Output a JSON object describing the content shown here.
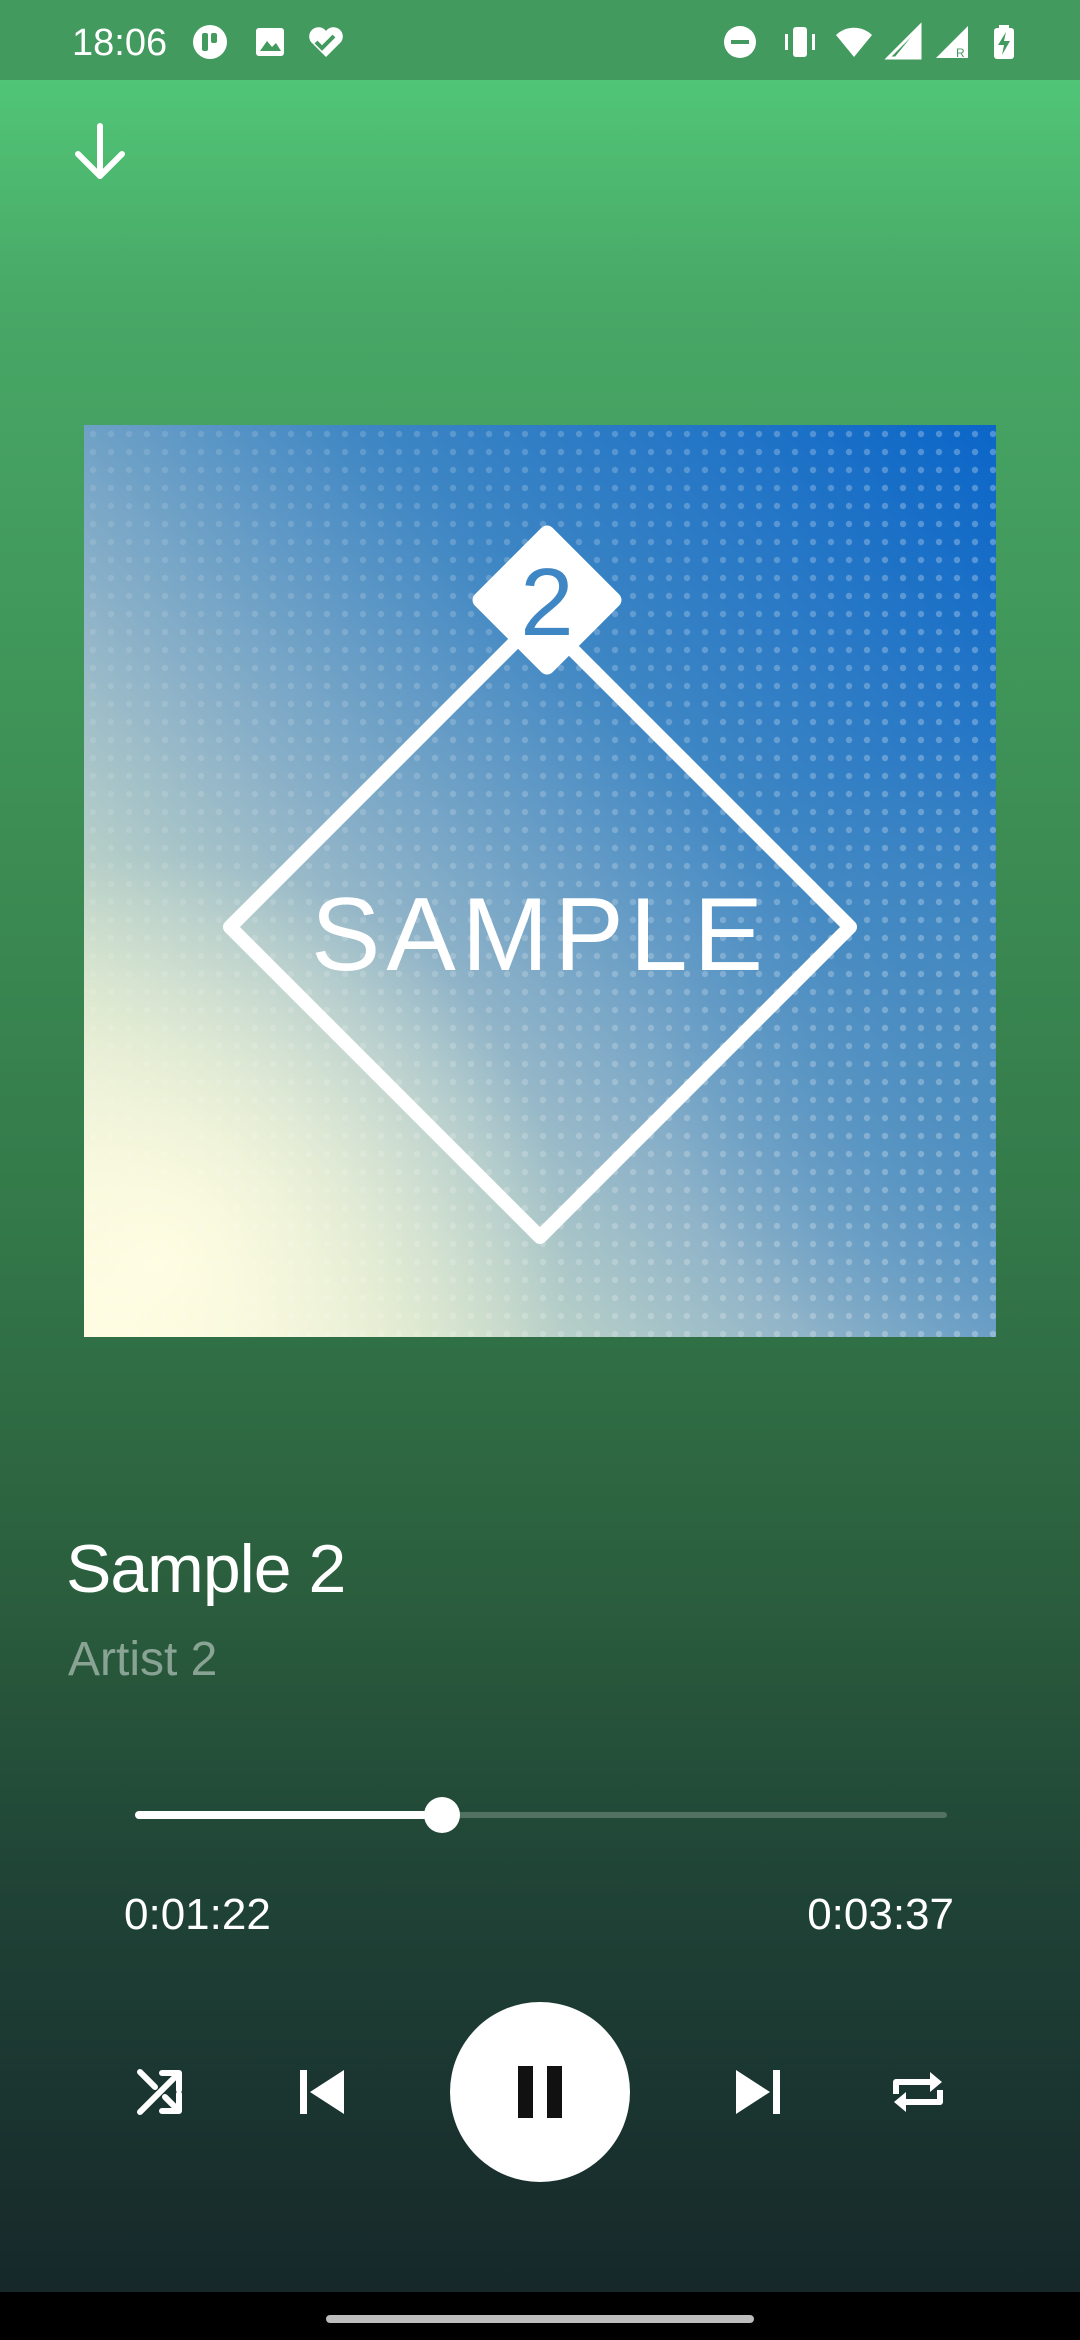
{
  "status_bar": {
    "time": "18:06",
    "left_icons": [
      "app-notification-icon",
      "image-icon",
      "health-icon"
    ],
    "right_icons": [
      "do-not-disturb-icon",
      "vibrate-icon",
      "wifi-icon",
      "signal-icon",
      "signal-roaming-icon",
      "battery-charging-icon"
    ]
  },
  "header": {
    "collapse_icon": "arrow-down-icon"
  },
  "album_art": {
    "text": "SAMPLE",
    "badge": "2"
  },
  "track": {
    "title": "Sample 2",
    "artist": "Artist 2"
  },
  "playback": {
    "elapsed": "0:01:22",
    "total": "0:03:37",
    "progress_fraction": 0.378,
    "state": "playing"
  },
  "controls": {
    "shuffle_icon": "shuffle-icon",
    "previous_icon": "skip-previous-icon",
    "play_pause_icon": "pause-icon",
    "next_icon": "skip-next-icon",
    "repeat_icon": "repeat-icon"
  },
  "colors": {
    "background_top": "#54d07d",
    "background_bottom": "#16282a",
    "accent": "#ffffff"
  }
}
